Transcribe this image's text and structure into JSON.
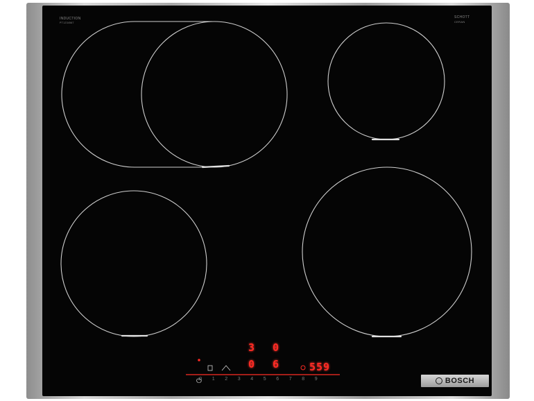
{
  "brand": {
    "induction_label": "INDUCTION",
    "induction_sub": "PT1234567",
    "top_right_label": "SCHOTT",
    "top_right_sub": "CERAN",
    "badge_text": "BOSCH"
  },
  "displays": {
    "zone_top_left": "3",
    "zone_top_right": "0",
    "zone_bottom_left": "0",
    "zone_bottom_right": "6",
    "timer": "559"
  },
  "slider": {
    "power_symbol": "⏻",
    "levels": [
      "0",
      "1",
      "2",
      "3",
      "4",
      "5",
      "6",
      "7",
      "8",
      "9"
    ]
  },
  "icons": {
    "lock": "lock-icon",
    "clock": "clock-icon",
    "combine": "combine-icon"
  },
  "colors": {
    "glass": "#050505",
    "display_red": "#ff2a24",
    "frame_steel": "#bdbdbd"
  }
}
